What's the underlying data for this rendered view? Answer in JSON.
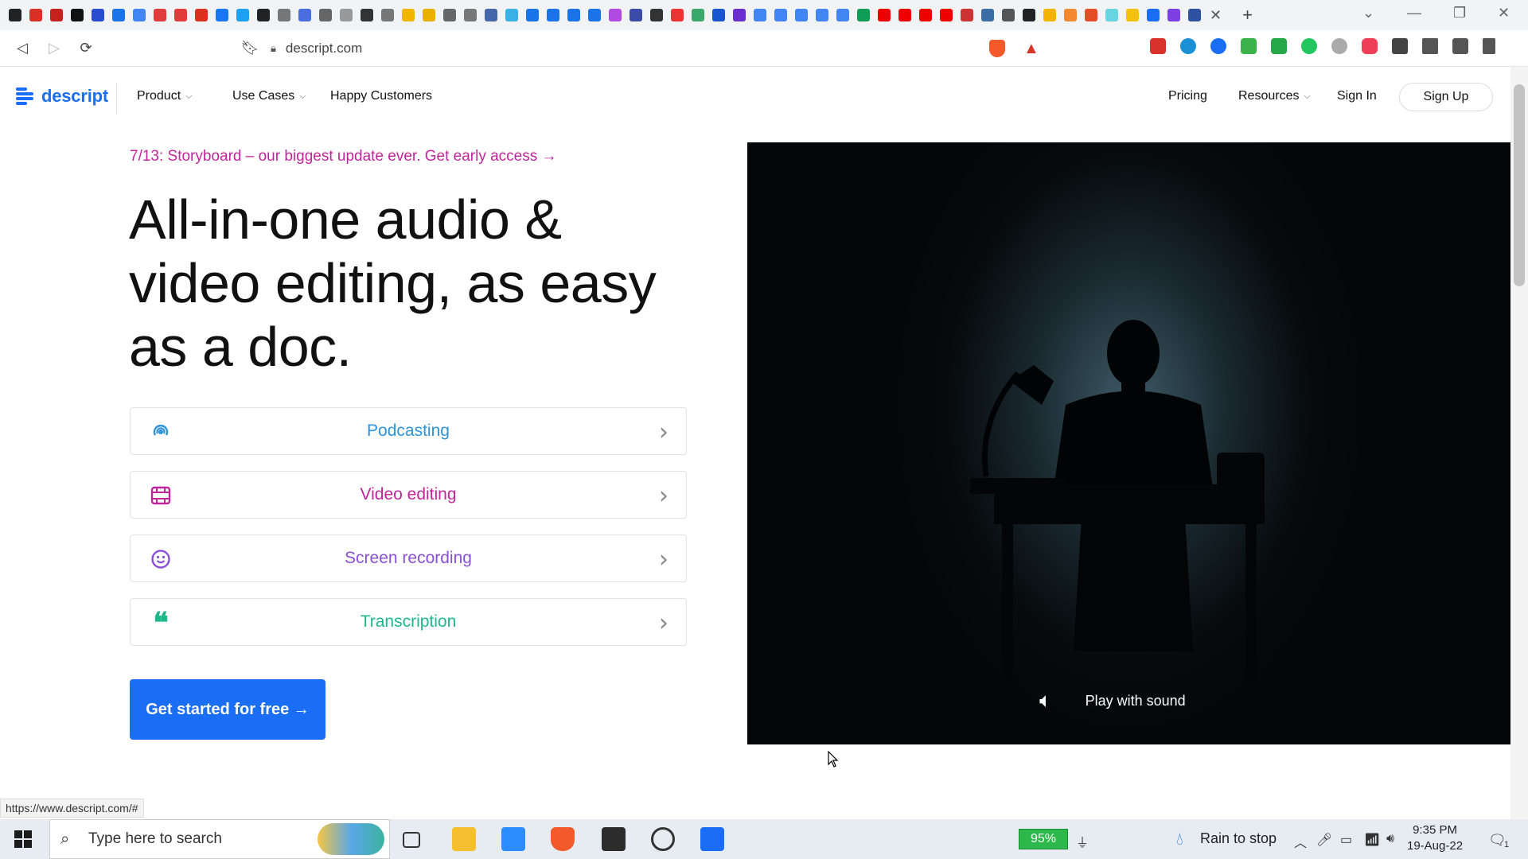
{
  "browser": {
    "url": "descript.com",
    "status_url": "https://www.descript.com/#",
    "new_tab": "+"
  },
  "site": {
    "logo_text": "descript",
    "nav": {
      "product": "Product",
      "use_cases": "Use Cases",
      "happy_customers": "Happy Customers",
      "pricing": "Pricing",
      "resources": "Resources",
      "sign_in": "Sign In",
      "sign_up": "Sign Up"
    }
  },
  "hero": {
    "announcement": "7/13: Storyboard – our biggest update ever. Get early access →",
    "title": "All-in-one audio & video editing, as easy as a doc.",
    "features": [
      {
        "label": "Podcasting",
        "color": "#2f93d6",
        "icon": "podcast-icon"
      },
      {
        "label": "Video editing",
        "color": "#c0259a",
        "icon": "film-icon"
      },
      {
        "label": "Screen recording",
        "color": "#8a4fd6",
        "icon": "smiley-icon"
      },
      {
        "label": "Transcription",
        "color": "#1db98a",
        "icon": "quote-icon"
      }
    ],
    "cta": "Get started for free →"
  },
  "video": {
    "play_label": "Play with sound"
  },
  "taskbar": {
    "search_placeholder": "Type here to search",
    "battery": "95%",
    "weather": "Rain to stop",
    "time": "9:35 PM",
    "date": "19-Aug-22",
    "notifications": "1"
  },
  "colors": {
    "brand_blue": "#1a6ef5",
    "announce_magenta": "#c0259a"
  }
}
